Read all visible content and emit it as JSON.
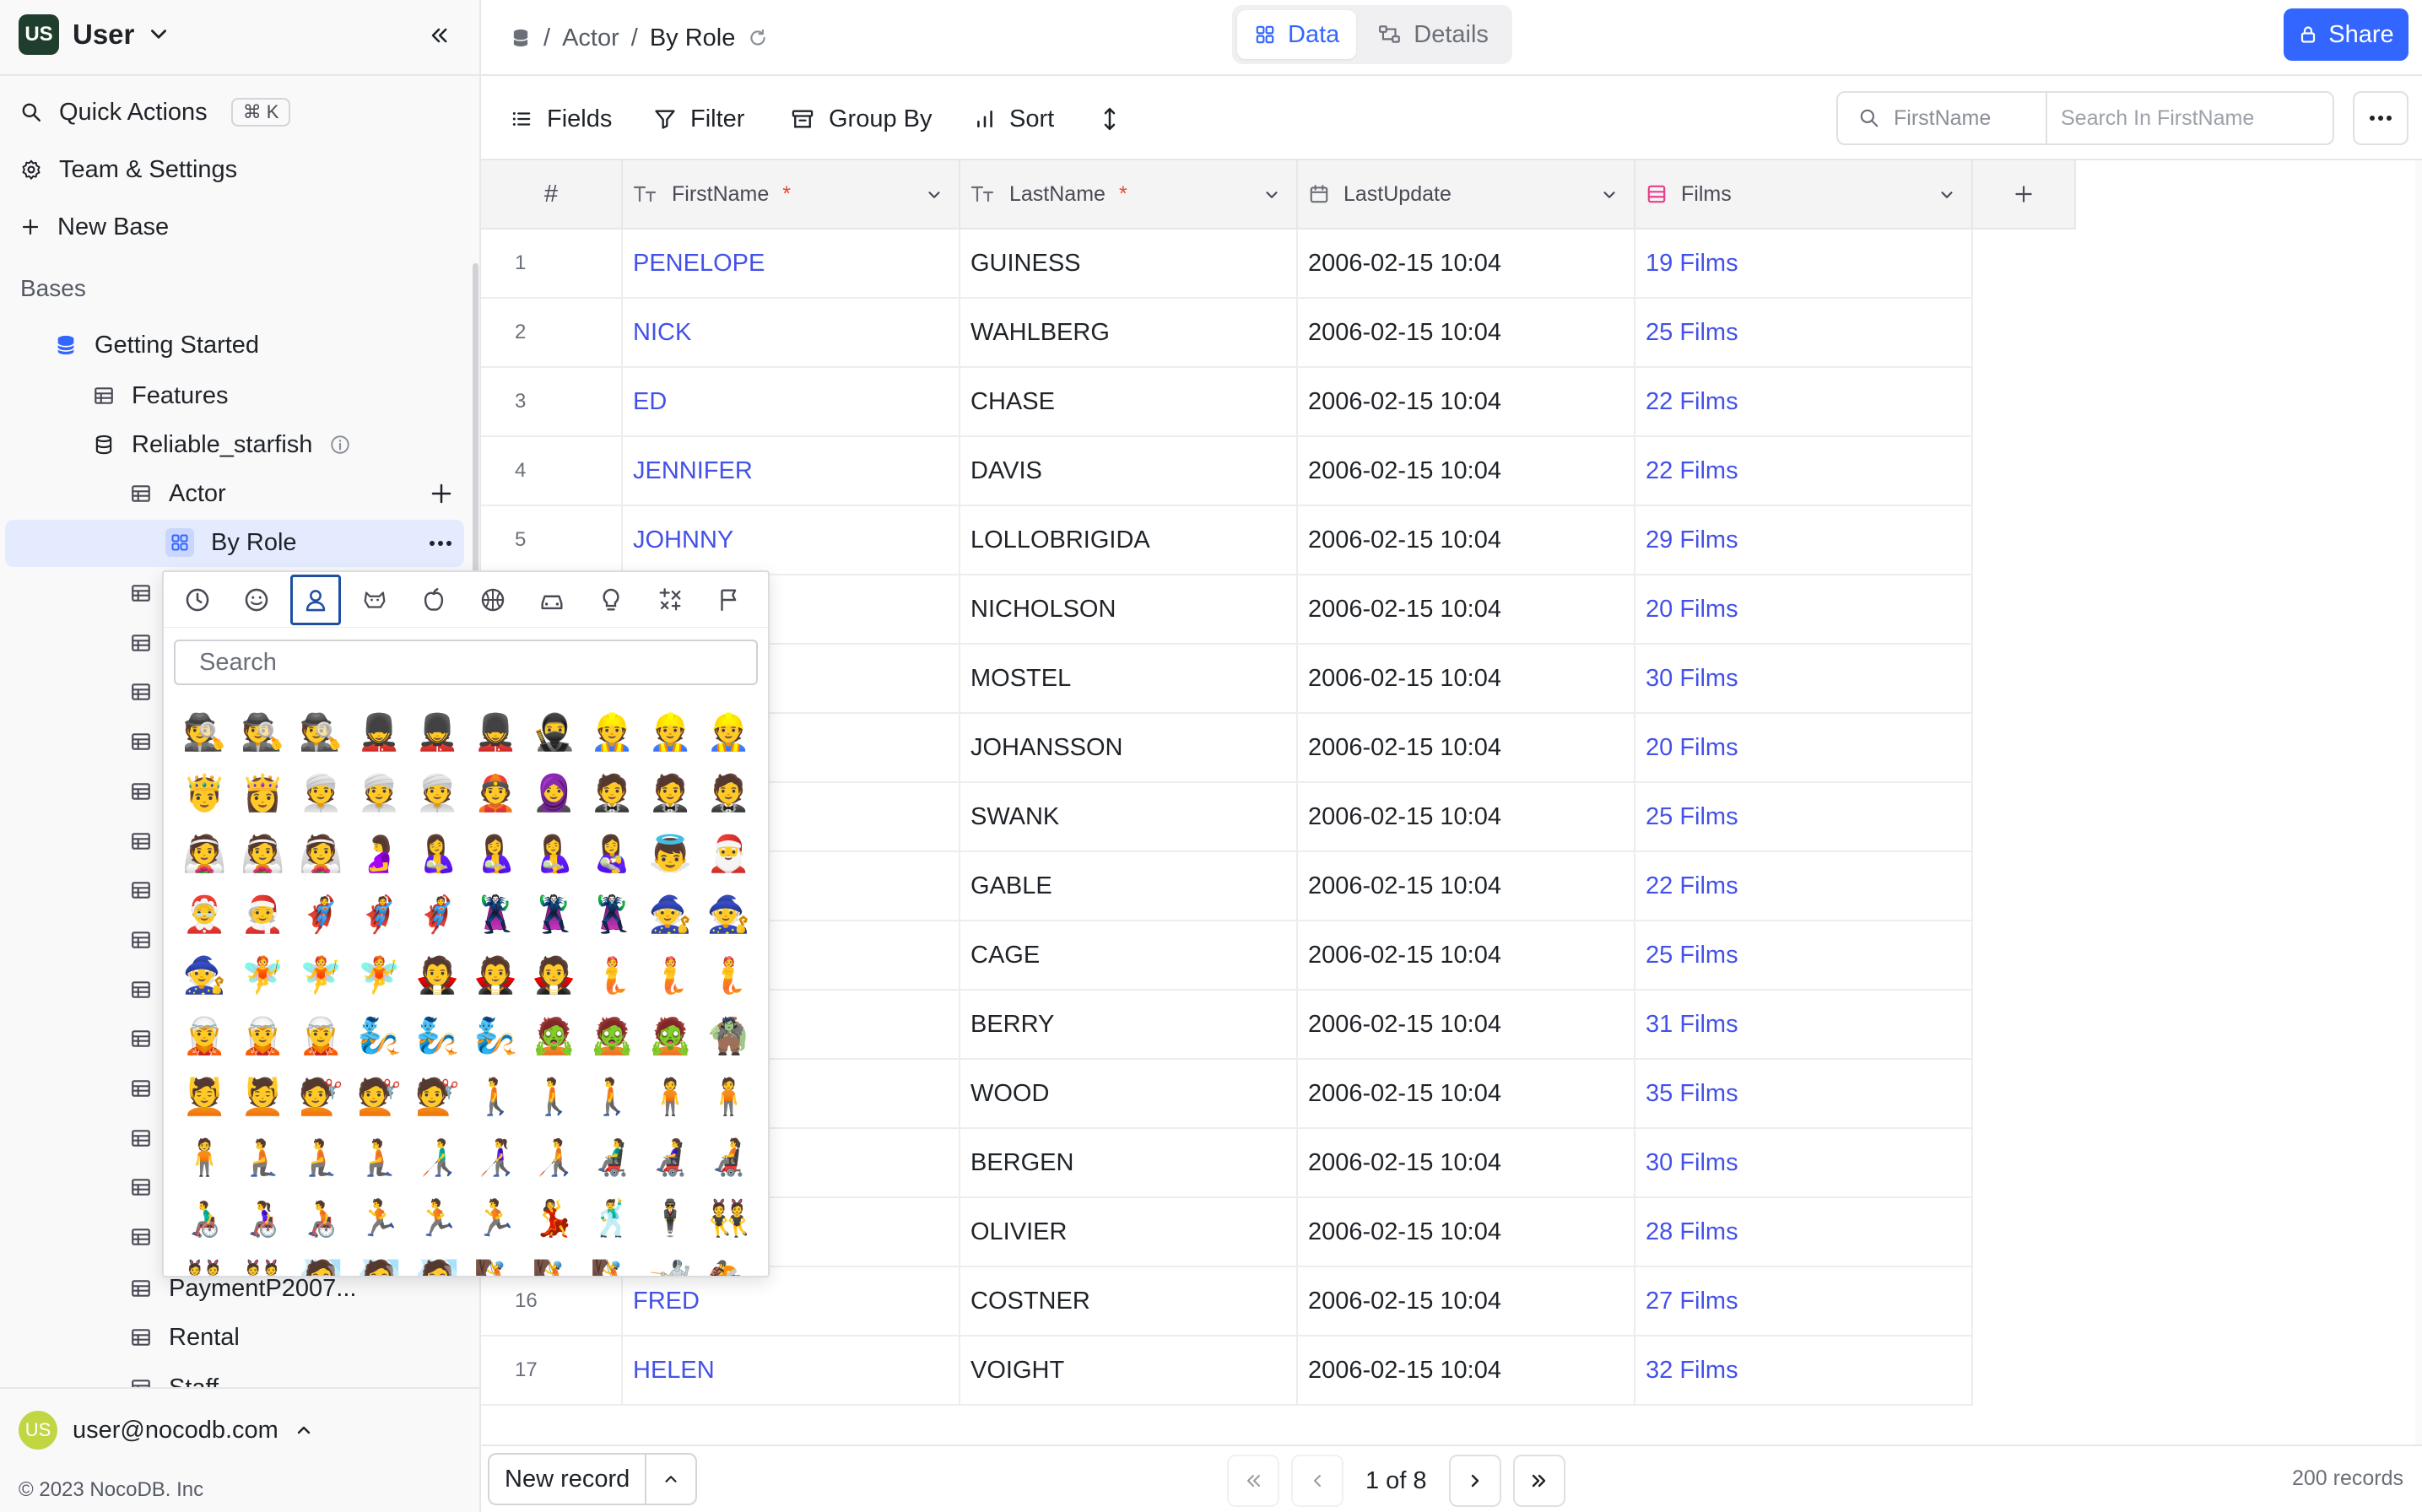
{
  "workspace": {
    "initials": "US",
    "name": "User"
  },
  "sidebar": {
    "quick_actions": "Quick Actions",
    "quick_actions_shortcut": "⌘ K",
    "team_settings": "Team & Settings",
    "new_base": "New Base",
    "bases_label": "Bases",
    "tree": {
      "getting_started": "Getting Started",
      "features": "Features",
      "reliable_starfish": "Reliable_starfish",
      "actor": "Actor",
      "by_role": "By Role",
      "payment": "PaymentP2007...",
      "rental": "Rental",
      "staff": "Staff"
    },
    "user_initials": "US",
    "user_email": "user@nocodb.com",
    "copyright": "© 2023 NocoDB. Inc"
  },
  "topbar": {
    "breadcrumb_sep": "/",
    "breadcrumb_table": "Actor",
    "breadcrumb_view": "By Role",
    "tab_data": "Data",
    "tab_details": "Details",
    "share": "Share"
  },
  "toolbar": {
    "fields": "Fields",
    "filter": "Filter",
    "group_by": "Group By",
    "sort": "Sort",
    "search_field": "FirstName",
    "search_placeholder": "Search In FirstName"
  },
  "grid": {
    "columns": [
      {
        "label": "#"
      },
      {
        "label": "FirstName",
        "required": "*"
      },
      {
        "label": "LastName",
        "required": "*"
      },
      {
        "label": "LastUpdate"
      },
      {
        "label": "Films"
      }
    ],
    "rows": [
      {
        "n": "1",
        "first": "PENELOPE",
        "last": "GUINESS",
        "updated": "2006-02-15 10:04",
        "films": "19 Films"
      },
      {
        "n": "2",
        "first": "NICK",
        "last": "WAHLBERG",
        "updated": "2006-02-15 10:04",
        "films": "25 Films"
      },
      {
        "n": "3",
        "first": "ED",
        "last": "CHASE",
        "updated": "2006-02-15 10:04",
        "films": "22 Films"
      },
      {
        "n": "4",
        "first": "JENNIFER",
        "last": "DAVIS",
        "updated": "2006-02-15 10:04",
        "films": "22 Films"
      },
      {
        "n": "5",
        "first": "JOHNNY",
        "last": "LOLLOBRIGIDA",
        "updated": "2006-02-15 10:04",
        "films": "29 Films"
      },
      {
        "n": "",
        "first": "",
        "last": "NICHOLSON",
        "updated": "2006-02-15 10:04",
        "films": "20 Films"
      },
      {
        "n": "",
        "first": "",
        "last": "MOSTEL",
        "updated": "2006-02-15 10:04",
        "films": "30 Films"
      },
      {
        "n": "",
        "first": "",
        "last": "JOHANSSON",
        "updated": "2006-02-15 10:04",
        "films": "20 Films"
      },
      {
        "n": "",
        "first": "",
        "last": "SWANK",
        "updated": "2006-02-15 10:04",
        "films": "25 Films"
      },
      {
        "n": "",
        "first": "",
        "last": "GABLE",
        "updated": "2006-02-15 10:04",
        "films": "22 Films"
      },
      {
        "n": "",
        "first": "",
        "last": "CAGE",
        "updated": "2006-02-15 10:04",
        "films": "25 Films"
      },
      {
        "n": "",
        "first": "",
        "last": "BERRY",
        "updated": "2006-02-15 10:04",
        "films": "31 Films"
      },
      {
        "n": "",
        "first": "",
        "last": "WOOD",
        "updated": "2006-02-15 10:04",
        "films": "35 Films"
      },
      {
        "n": "",
        "first": "",
        "last": "BERGEN",
        "updated": "2006-02-15 10:04",
        "films": "30 Films"
      },
      {
        "n": "",
        "first": "",
        "last": "OLIVIER",
        "updated": "2006-02-15 10:04",
        "films": "28 Films"
      },
      {
        "n": "16",
        "first": "FRED",
        "last": "COSTNER",
        "updated": "2006-02-15 10:04",
        "films": "27 Films"
      },
      {
        "n": "17",
        "first": "HELEN",
        "last": "VOIGHT",
        "updated": "2006-02-15 10:04",
        "films": "32 Films"
      }
    ]
  },
  "footer": {
    "new_record": "New record",
    "page": "1 of 8",
    "records": "200 records"
  },
  "emoji_picker": {
    "search_placeholder": "Search",
    "categories": [
      "recent-icon",
      "smileys-icon",
      "people-icon",
      "animals-icon",
      "food-icon",
      "activity-icon",
      "travel-icon",
      "objects-icon",
      "symbols-icon",
      "flags-icon"
    ],
    "active_category": "people-icon",
    "emojis": [
      "🕵️",
      "🕵️",
      "🕵️",
      "💂",
      "💂",
      "💂",
      "🥷",
      "👷",
      "👷",
      "👷",
      "🤴",
      "👸",
      "👳",
      "👳",
      "👳",
      "👲",
      "🧕",
      "🤵",
      "🤵",
      "🤵",
      "👰",
      "👰",
      "👰",
      "🤰",
      "🤱",
      "🤱",
      "🤱",
      "👩‍🍼",
      "👼",
      "🎅",
      "🤶",
      "🧑‍🎄",
      "🦸",
      "🦸",
      "🦸",
      "🦹",
      "🦹",
      "🦹",
      "🧙",
      "🧙",
      "🧙",
      "🧚",
      "🧚",
      "🧚",
      "🧛",
      "🧛",
      "🧛",
      "🧜",
      "🧜",
      "🧜",
      "🧝",
      "🧝",
      "🧝",
      "🧞",
      "🧞",
      "🧞",
      "🧟",
      "🧟",
      "🧟",
      "🧌",
      "💆",
      "💆",
      "💇",
      "💇",
      "💇",
      "🚶",
      "🚶",
      "🚶",
      "🧍",
      "🧍",
      "🧍",
      "🧎",
      "🧎",
      "🧎",
      "👨‍🦯",
      "👩‍🦯",
      "🧑‍🦯",
      "👨‍🦼",
      "👩‍🦼",
      "🧑‍🦼",
      "👨‍🦽",
      "👩‍🦽",
      "🧑‍🦽",
      "🏃",
      "🏃",
      "🏃",
      "💃",
      "🕺",
      "🕴️",
      "👯",
      "👯",
      "👯",
      "🧖",
      "🧖",
      "🧖",
      "🧗",
      "🧗",
      "🧗",
      "🤺",
      "🏇"
    ]
  }
}
